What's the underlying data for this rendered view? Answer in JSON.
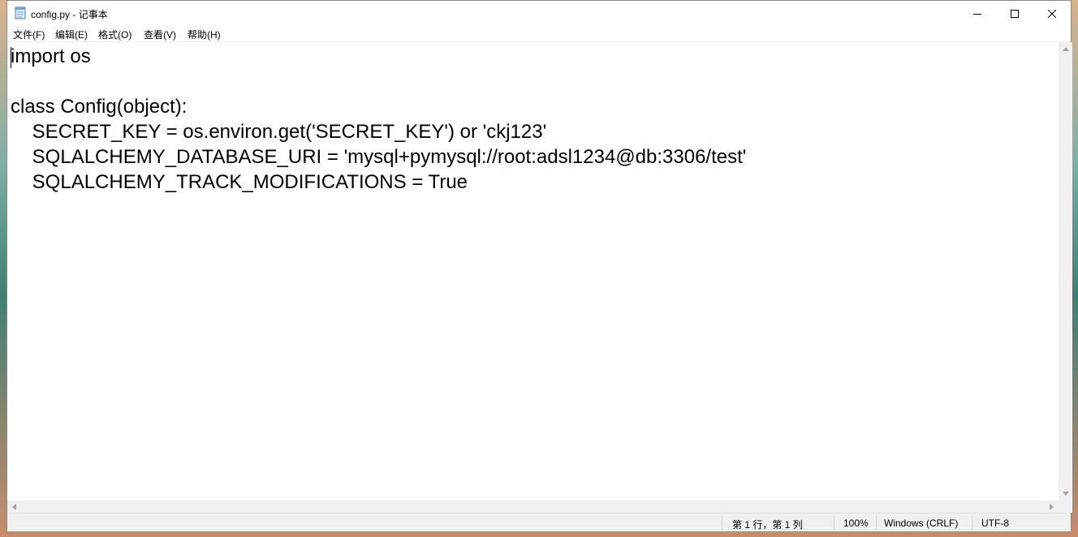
{
  "window": {
    "title": "config.py - 记事本"
  },
  "menu": {
    "items": [
      "文件(F)",
      "编辑(E)",
      "格式(O)",
      "查看(V)",
      "帮助(H)"
    ]
  },
  "editor": {
    "lines": [
      "import os",
      "",
      "class Config(object):",
      "    SECRET_KEY = os.environ.get('SECRET_KEY') or 'ckj123'",
      "    SQLALCHEMY_DATABASE_URI = 'mysql+pymysql://root:adsl1234@db:3306/test'",
      "    SQLALCHEMY_TRACK_MODIFICATIONS = True"
    ]
  },
  "statusbar": {
    "position": "第 1 行，第 1 列",
    "zoom": "100%",
    "line_ending": "Windows (CRLF)",
    "encoding": "UTF-8"
  },
  "icons": [
    "notepad-icon",
    "minimize-icon",
    "maximize-icon",
    "close-icon",
    "scroll-up-icon",
    "scroll-down-icon",
    "scroll-left-icon",
    "scroll-right-icon"
  ]
}
